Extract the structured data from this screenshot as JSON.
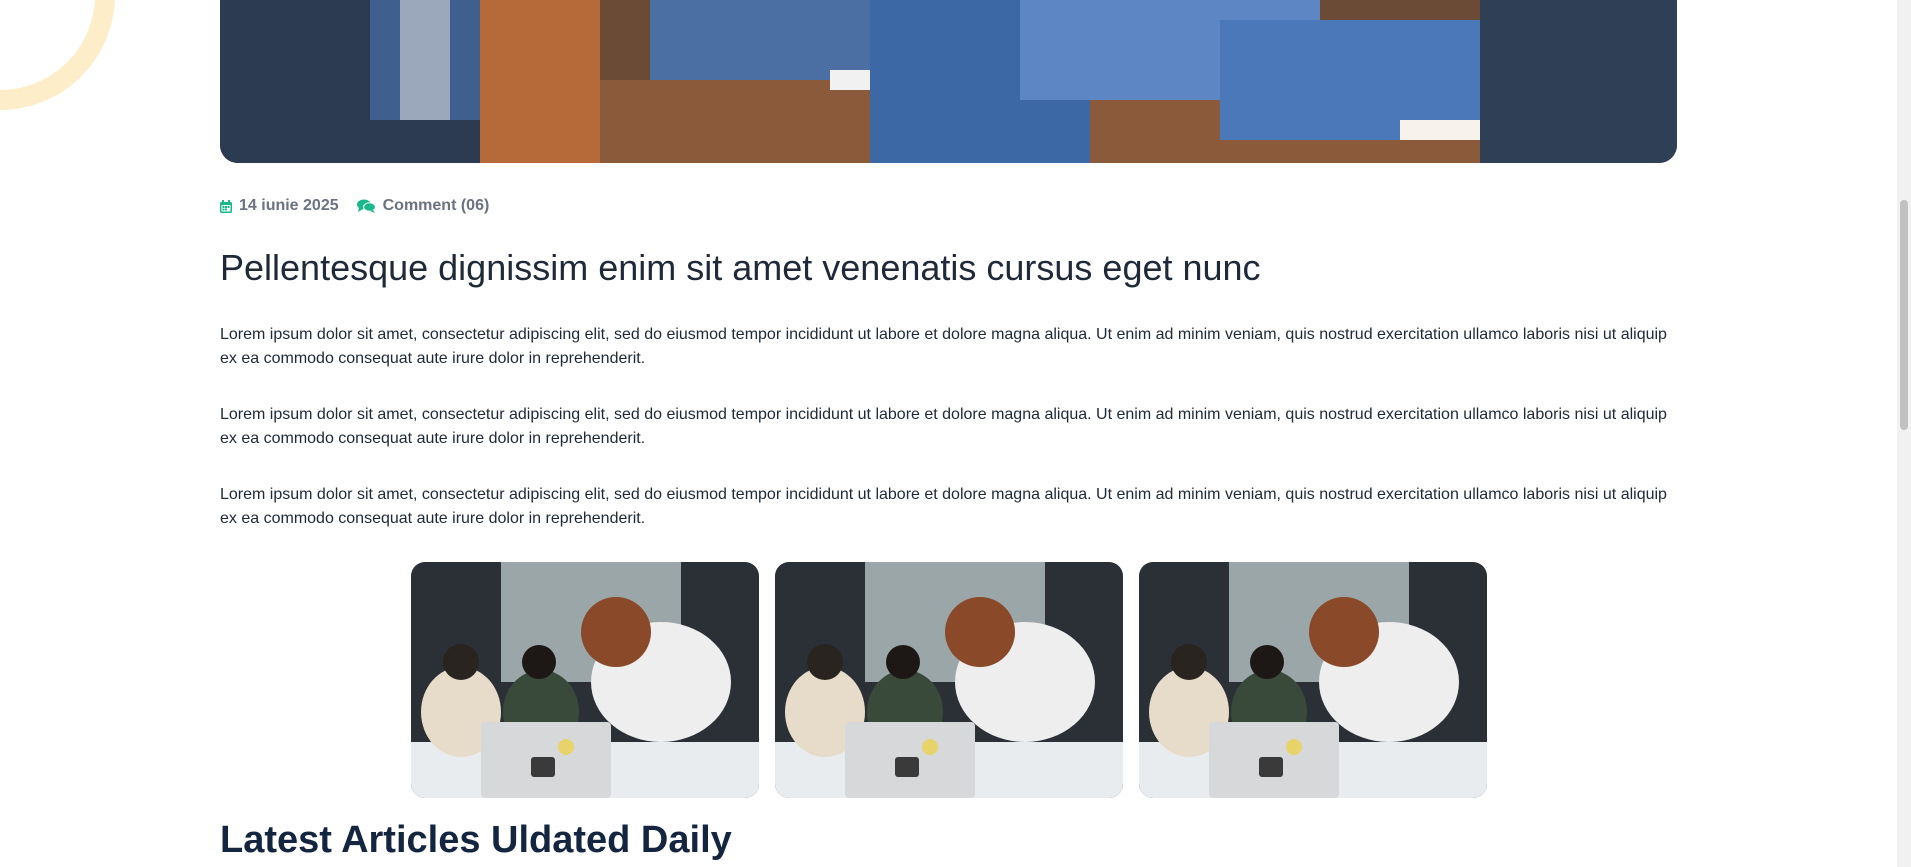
{
  "colors": {
    "accent": "#1ab98b",
    "heading": "#1f2937",
    "section_heading": "#14253f",
    "meta_text": "#6b7280",
    "decor_ring": "#fdedc9"
  },
  "hero": {
    "image_subject": "people in jeans sitting on chairs"
  },
  "meta": {
    "date_icon": "calendar-icon",
    "date": "14 iunie 2025",
    "comment_icon": "comments-icon",
    "comments": "Comment (06)"
  },
  "article": {
    "title": "Pellentesque dignissim enim sit amet venenatis cursus eget nunc",
    "paragraphs": [
      "Lorem ipsum dolor sit amet, consectetur adipiscing elit, sed do eiusmod tempor incididunt ut labore et dolore magna aliqua. Ut enim ad minim veniam, quis nostrud exercitation ullamco laboris nisi ut aliquip ex ea commodo consequat aute irure dolor in reprehenderit.",
      "Lorem ipsum dolor sit amet, consectetur adipiscing elit, sed do eiusmod tempor incididunt ut labore et dolore magna aliqua. Ut enim ad minim veniam, quis nostrud exercitation ullamco laboris nisi ut aliquip ex ea commodo consequat aute irure dolor in reprehenderit.",
      "Lorem ipsum dolor sit amet, consectetur adipiscing elit, sed do eiusmod tempor incididunt ut labore et dolore magna aliqua. Ut enim ad minim veniam, quis nostrud exercitation ullamco laboris nisi ut aliquip ex ea commodo consequat aute irure dolor in reprehenderit."
    ]
  },
  "gallery": {
    "images": [
      {
        "subject": "students around a laptop"
      },
      {
        "subject": "students around a laptop"
      },
      {
        "subject": "students around a laptop"
      }
    ]
  },
  "latest": {
    "title": "Latest Articles Uldated Daily"
  }
}
